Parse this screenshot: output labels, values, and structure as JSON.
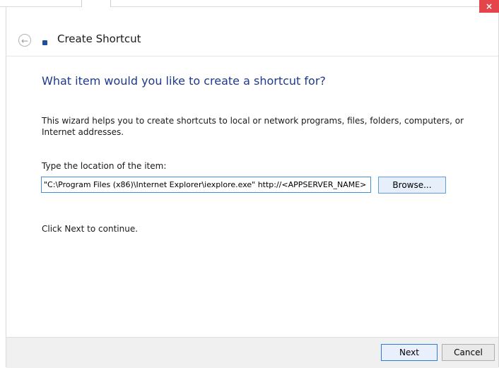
{
  "window": {
    "close_glyph": "×"
  },
  "nav": {
    "back_glyph": "←",
    "title": "Create Shortcut"
  },
  "content": {
    "heading": "What item would you like to create a shortcut for?",
    "description": "This wizard helps you to create shortcuts to local or network programs, files, folders, computers, or Internet addresses.",
    "location_label": "Type the location of the item:",
    "location_value": "\"C:\\Program Files (x86)\\Internet Explorer\\iexplore.exe\" http://<APPSERVER_NAME>",
    "browse_label": "Browse...",
    "continue_text": "Click Next to continue."
  },
  "footer": {
    "next_label": "Next",
    "cancel_label": "Cancel"
  },
  "colors": {
    "heading": "#1e3a8a",
    "close_button": "#e4454b",
    "focus_border": "#3f8fd6"
  }
}
